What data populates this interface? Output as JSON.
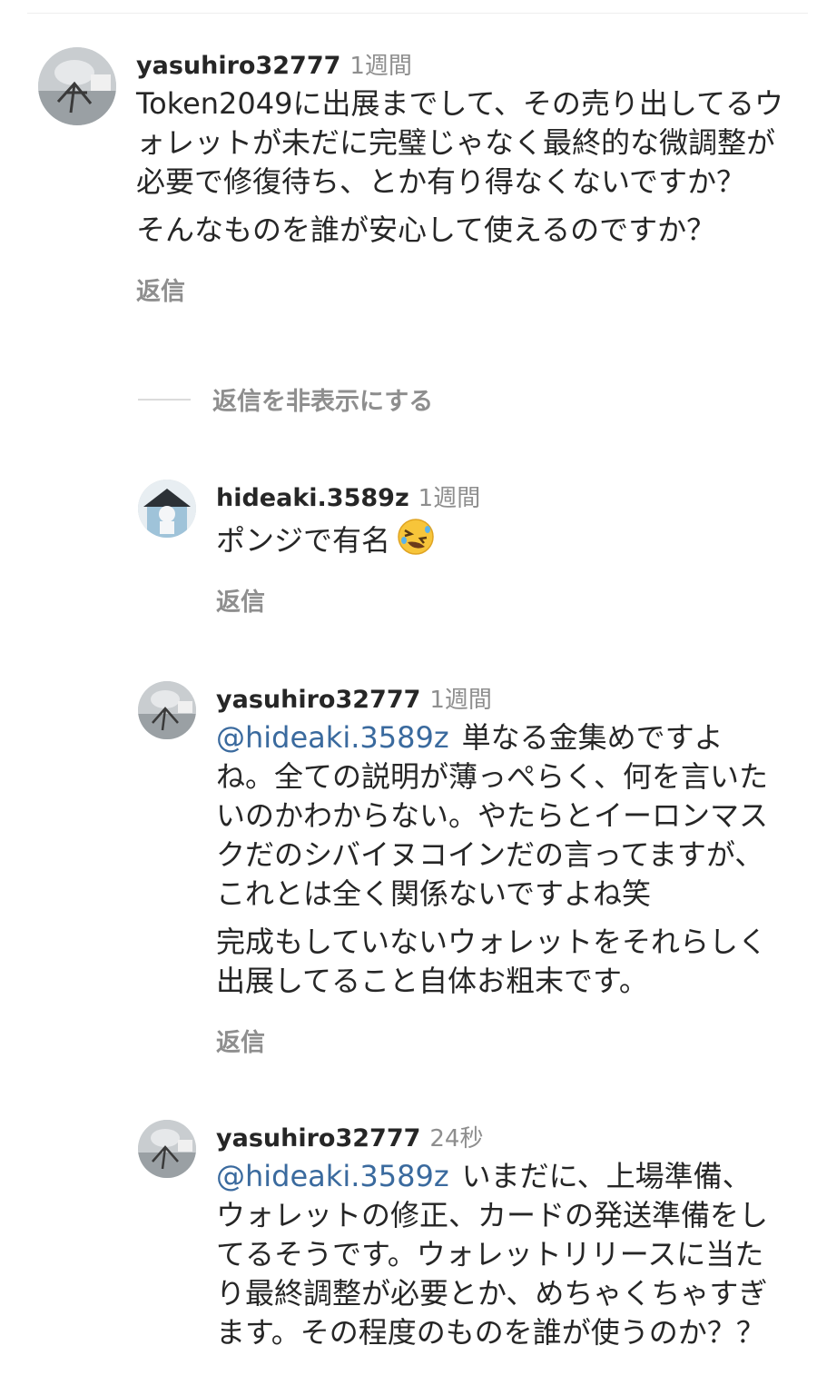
{
  "comments": [
    {
      "username": "yasuhiro32777",
      "time": "1週間",
      "paragraphs": [
        "Token2049に出展までして、その売り出してるウォレットが未だに完璧じゃなく最終的な微調整が必要で修復待ち、とか有り得なくないですか？",
        "そんなものを誰が安心して使えるのですか？"
      ],
      "reply_label": "返信"
    },
    {
      "username": "hideaki.3589z",
      "time": "1週間",
      "text": "ポンジで有名",
      "emoji_icon": "rolling-on-floor-laughing-emoji",
      "reply_label": "返信"
    },
    {
      "username": "yasuhiro32777",
      "time": "1週間",
      "mention": "@hideaki.3589z",
      "paragraphs": [
        "単なる金集めですよね。全ての説明が薄っぺらく、何を言いたいのかわからない。やたらとイーロンマスクだのシバイヌコインだの言ってますが、これとは全く関係ないですよね笑",
        "完成もしていないウォレットをそれらしく出展してること自体お粗末です。"
      ],
      "reply_label": "返信"
    },
    {
      "username": "yasuhiro32777",
      "time": "24秒",
      "mention": "@hideaki.3589z",
      "paragraphs": [
        "いまだに、上場準備、ウォレットの修正、カードの発送準備をしてるそうです。ウォレットリリースに当たり最終調整が必要とか、めちゃくちゃすぎます。その程度のものを誰が使うのか？？"
      ]
    }
  ],
  "hide_replies_label": "返信を非表示にする",
  "colors": {
    "text": "#262626",
    "secondary": "#8e8e8e",
    "mention": "#3a6a9e",
    "divider": "#dbdbdb"
  }
}
